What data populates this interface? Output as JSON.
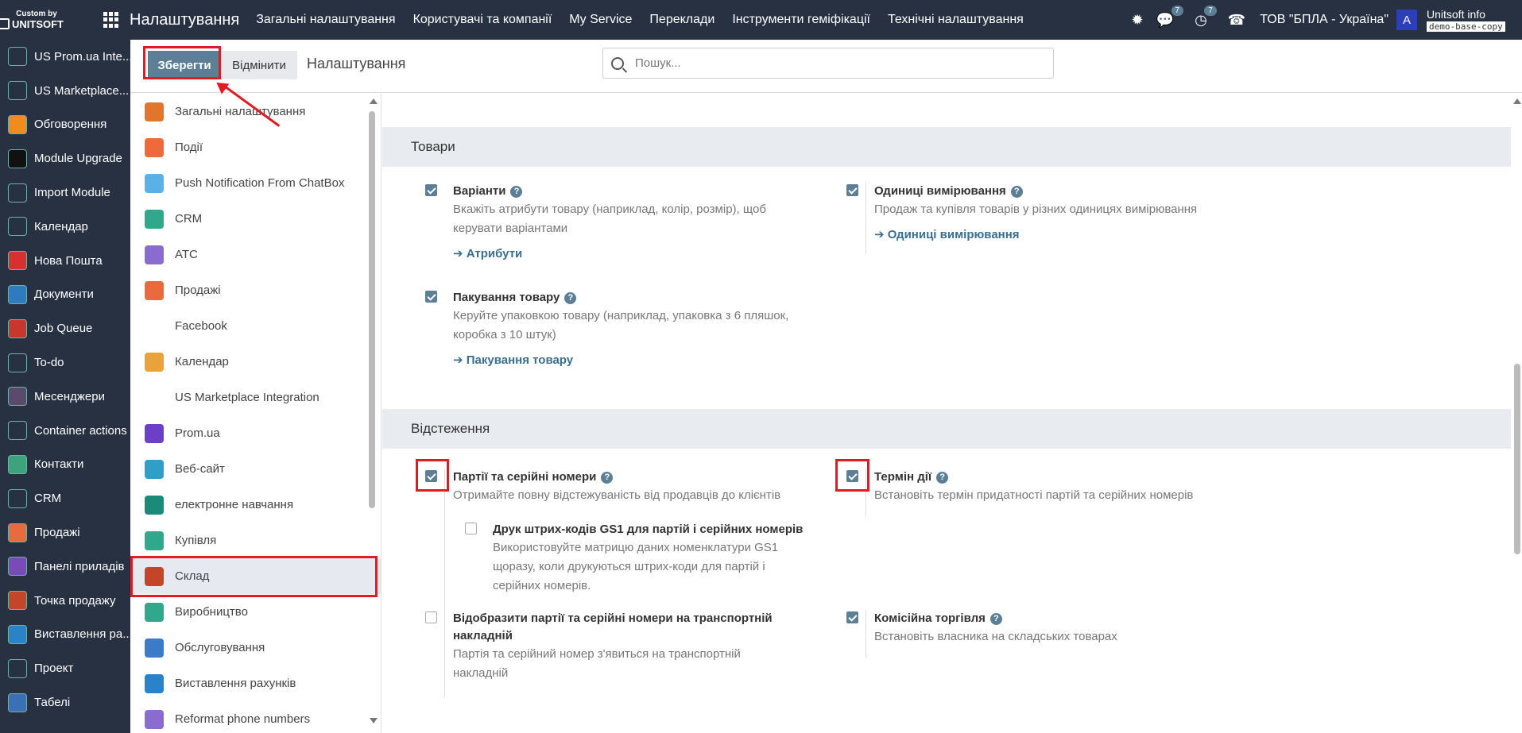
{
  "topbar": {
    "logo_line1": "Custom by",
    "logo_line2": "UNITSOFT",
    "app_title": "Налаштування",
    "menu": [
      "Загальні налаштування",
      "Користувачі та компанії",
      "My Service",
      "Переклади",
      "Інструменти геміфікації",
      "Технічні налаштування"
    ],
    "chat_count": "7",
    "activity_count": "7",
    "company": "ТОВ \"БПЛА - Україна\"",
    "avatar_letter": "A",
    "user_name": "Unitsoft info",
    "db_name": "demo-base-copy"
  },
  "apps": [
    {
      "label": "US Prom.ua Inte...",
      "icon": "cube-icon",
      "color": "#273142"
    },
    {
      "label": "US Marketplace...",
      "icon": "cube-icon",
      "color": "#273142"
    },
    {
      "label": "Обговорення",
      "icon": "chat-bubble-icon",
      "color": "#f28b1d"
    },
    {
      "label": "Module Upgrade",
      "icon": "upgrade-icon",
      "color": "#111111"
    },
    {
      "label": "Import Module",
      "icon": "import-icon",
      "color": "#273142"
    },
    {
      "label": "Календар",
      "icon": "calendar-icon",
      "color": "#273142"
    },
    {
      "label": "Нова Пошта",
      "icon": "nova-poshta-icon",
      "color": "#d92f2f"
    },
    {
      "label": "Документи",
      "icon": "documents-icon",
      "color": "#2f7bbf"
    },
    {
      "label": "Job Queue",
      "icon": "job-queue-icon",
      "color": "#c8372d"
    },
    {
      "label": "To-do",
      "icon": "todo-icon",
      "color": "#273142"
    },
    {
      "label": "Месенджери",
      "icon": "messenger-icon",
      "color": "#5b4a6b"
    },
    {
      "label": "Container actions",
      "icon": "container-icon",
      "color": "#273142"
    },
    {
      "label": "Контакти",
      "icon": "contacts-icon",
      "color": "#3ca37c"
    },
    {
      "label": "CRM",
      "icon": "crm-icon",
      "color": "#273142"
    },
    {
      "label": "Продажі",
      "icon": "sales-icon",
      "color": "#e76b3c"
    },
    {
      "label": "Панелі приладів",
      "icon": "dashboard-icon",
      "color": "#7a4bb8"
    },
    {
      "label": "Точка продажу",
      "icon": "pos-icon",
      "color": "#c3452a"
    },
    {
      "label": "Виставлення ра...",
      "icon": "invoice-icon",
      "color": "#2a83c9"
    },
    {
      "label": "Проект",
      "icon": "project-icon",
      "color": "#273142"
    },
    {
      "label": "Табелі",
      "icon": "timesheet-icon",
      "color": "#3b6fb6"
    }
  ],
  "control": {
    "save_label": "Зберегти",
    "cancel_label": "Відмінити",
    "title": "Налаштування",
    "search_placeholder": "Пошук..."
  },
  "settings_sidebar": [
    {
      "label": "Загальні налаштування",
      "icon": "general-settings-icon",
      "color": "#e0762b",
      "active": false
    },
    {
      "label": "Події",
      "icon": "events-icon",
      "color": "#ef6a3a",
      "active": false
    },
    {
      "label": "Push Notification From ChatBox",
      "icon": "push-notification-icon",
      "color": "#5ab1e6",
      "active": false
    },
    {
      "label": "CRM",
      "icon": "crm-icon",
      "color": "#2fa88c",
      "active": false
    },
    {
      "label": "АТС",
      "icon": "phone-icon",
      "color": "#8a6cd1",
      "active": false
    },
    {
      "label": "Продажі",
      "icon": "sales-icon",
      "color": "#e76b3c",
      "active": false
    },
    {
      "label": "Facebook",
      "icon": "",
      "color": "",
      "active": false
    },
    {
      "label": "Календар",
      "icon": "calendar-icon",
      "color": "#e8a33a",
      "active": false
    },
    {
      "label": "US Marketplace Integration",
      "icon": "",
      "color": "",
      "active": false
    },
    {
      "label": "Prom.ua",
      "icon": "prom-icon",
      "color": "#6c3fc7",
      "active": false
    },
    {
      "label": "Веб-сайт",
      "icon": "website-icon",
      "color": "#2f9fc7",
      "active": false
    },
    {
      "label": "електронне навчання",
      "icon": "elearning-icon",
      "color": "#1c8a79",
      "active": false
    },
    {
      "label": "Купівля",
      "icon": "purchase-icon",
      "color": "#2fa88c",
      "active": false
    },
    {
      "label": "Склад",
      "icon": "inventory-icon",
      "color": "#c3452a",
      "active": true
    },
    {
      "label": "Виробництво",
      "icon": "manufacturing-icon",
      "color": "#2fa88c",
      "active": false
    },
    {
      "label": "Обслуговування",
      "icon": "maintenance-icon",
      "color": "#3b7bc7",
      "active": false
    },
    {
      "label": "Виставлення рахунків",
      "icon": "invoice-icon",
      "color": "#2a83c9",
      "active": false
    },
    {
      "label": "Reformat phone numbers",
      "icon": "phone-icon",
      "color": "#8a6cd1",
      "active": false
    }
  ],
  "sections": {
    "products": {
      "title": "Товари",
      "options": [
        {
          "title": "Варіанти",
          "checked": true,
          "desc": "Вкажіть атрибути товару (наприклад, колір, розмір), щоб керувати варіантами",
          "link": "Атрибути"
        },
        {
          "title": "Одиниці вимірювання",
          "checked": true,
          "desc": "Продаж та купівля товарів у різних одиницях вимірювання",
          "link": "Одиниці вимірювання"
        },
        {
          "title": "Пакування товару",
          "checked": true,
          "desc": "Керуйте упаковкою товару (наприклад, упаковка з 6 пляшок, коробка з 10 штук)",
          "link": "Пакування товару"
        }
      ]
    },
    "tracking": {
      "title": "Відстеження",
      "options": [
        {
          "title": "Партії та серійні номери",
          "checked": true,
          "desc": "Отримайте повну відстежуваність від продавців до клієнтів"
        },
        {
          "title": "Термін дії",
          "checked": true,
          "desc": "Встановіть термін придатності партій та серійних номерів"
        },
        {
          "title": "Друк штрих-кодів GS1 для партій і серійних номерів",
          "checked": false,
          "desc": "Використовуйте матрицю даних номенклатури GS1 щоразу, коли друкуються штрих-коди для партій і серійних номерів."
        },
        {
          "title": "Відобразити партії та серійні номери на транспортній накладній",
          "checked": false,
          "desc": "Партія та серійний номер з'явиться на транспортній накладній"
        },
        {
          "title": "Комісійна торгівля",
          "checked": true,
          "desc": "Встановіть власника на складських товарах"
        }
      ]
    }
  },
  "colors": {
    "navbar": "#273142",
    "primary": "#5c7f96",
    "annotation": "#e01b24"
  }
}
